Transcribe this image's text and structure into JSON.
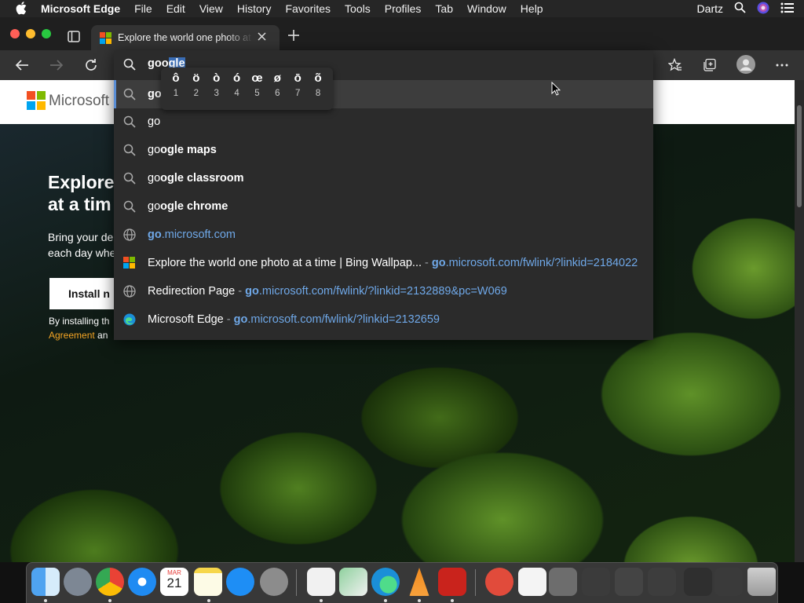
{
  "menubar": {
    "app_name": "Microsoft Edge",
    "items": [
      "File",
      "Edit",
      "View",
      "History",
      "Favorites",
      "Tools",
      "Profiles",
      "Tab",
      "Window",
      "Help"
    ],
    "user": "Dartz"
  },
  "tab": {
    "title": "Explore the world one photo at a time"
  },
  "omnibox": {
    "typed": "goo",
    "selected_suggestion": "gle"
  },
  "accent_popup": {
    "chars": [
      "ô",
      "ö",
      "ò",
      "ó",
      "œ",
      "ø",
      "ō",
      "õ"
    ],
    "nums": [
      "1",
      "2",
      "3",
      "4",
      "5",
      "6",
      "7",
      "8"
    ]
  },
  "suggestions": {
    "r1": {
      "text": "go"
    },
    "r2": {
      "text": "go"
    },
    "r3": {
      "prefix": "go",
      "rest": "ogle maps"
    },
    "r4": {
      "prefix": "go",
      "rest": "ogle classroom"
    },
    "r5": {
      "prefix": "go",
      "rest": "ogle chrome"
    },
    "r6": {
      "prefix": "go",
      "rest": ".microsoft.com"
    },
    "r7": {
      "title": "Explore the world one photo at a time | Bing Wallpap...",
      "sep": "-",
      "url_prefix": "go",
      "url_rest": ".microsoft.com/fwlink/?linkid=2184022"
    },
    "r8": {
      "title": "Redirection Page",
      "sep": "-",
      "url_prefix": "go",
      "url_rest": ".microsoft.com/fwlink/?linkid=2132889&pc=W069"
    },
    "r9": {
      "title": "Microsoft Edge",
      "sep": "-",
      "url_prefix": "go",
      "url_rest": ".microsoft.com/fwlink/?linkid=2132659"
    }
  },
  "page": {
    "brand": "Microsoft",
    "hero_title": "Explore at a tim",
    "hero_text_1": "Bring your de",
    "hero_text_2": "each day whe",
    "install_label": "Install n",
    "fine_1": "By installing th",
    "fine_link": "Agreement",
    "fine_2": " an"
  },
  "dock": {
    "calendar_month": "MAR",
    "calendar_day": "21"
  },
  "colors": {
    "accent_blue": "#6fa8e8",
    "selection": "#3a6db5",
    "ms_red": "#f25022",
    "ms_green": "#7fba00",
    "ms_blue": "#00a4ef",
    "ms_yellow": "#ffb900"
  }
}
